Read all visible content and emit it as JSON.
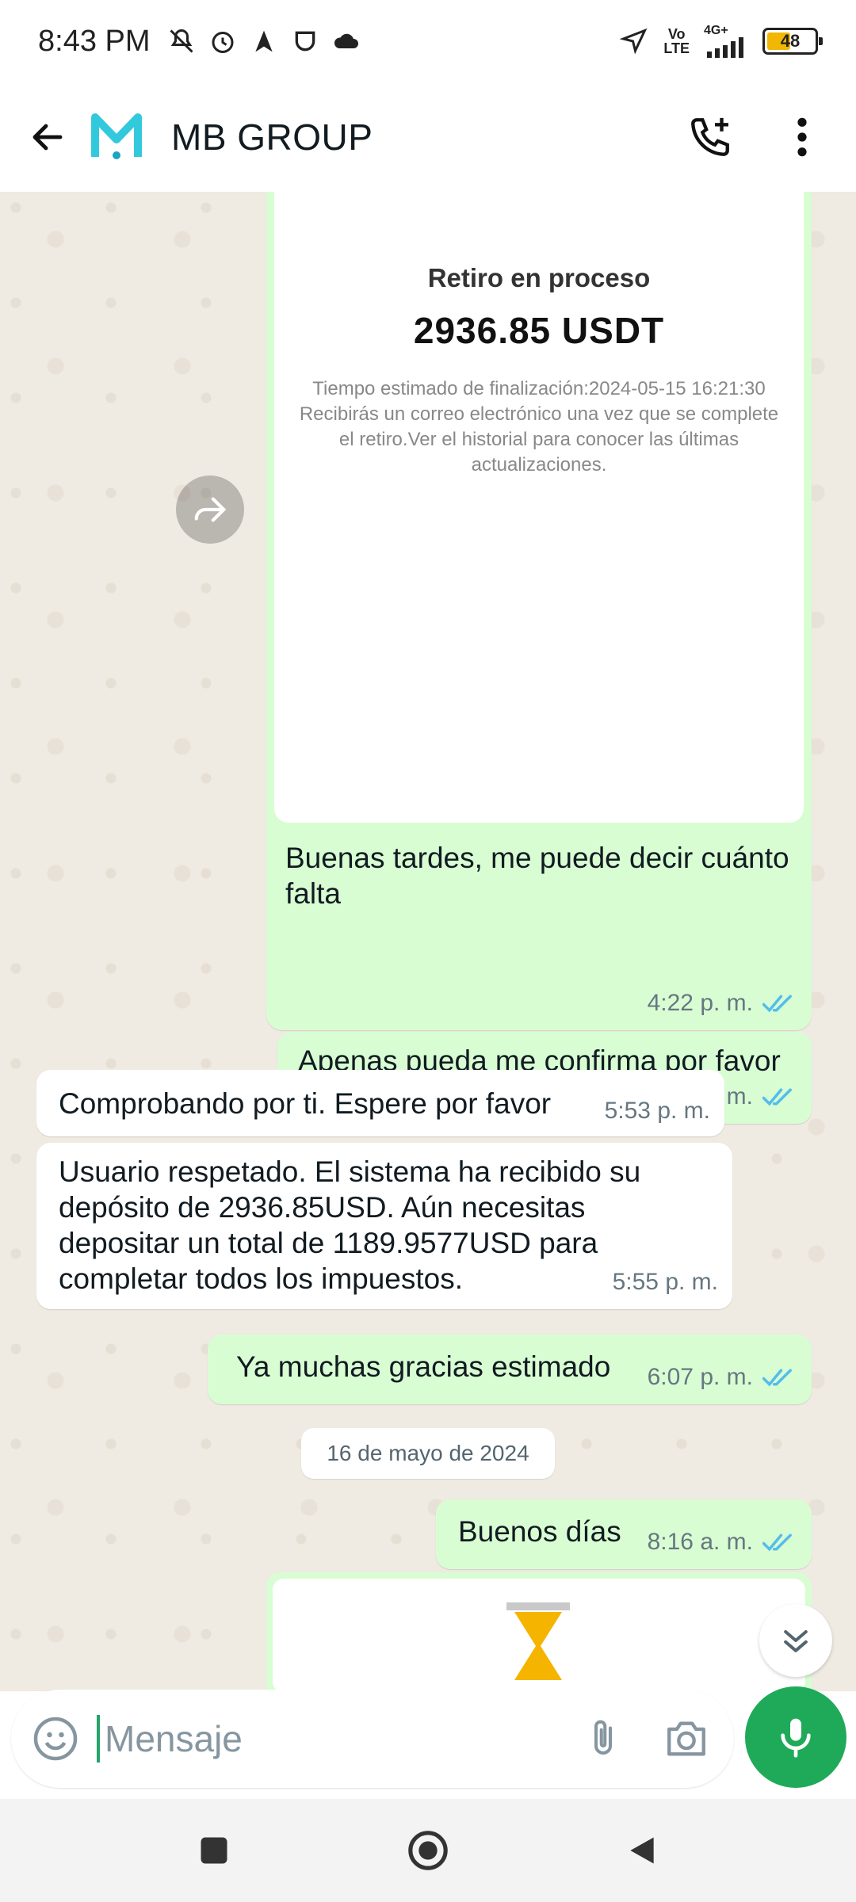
{
  "status_bar": {
    "time": "8:43 PM",
    "volte_top": "Vo",
    "volte_bottom": "LTE",
    "network": "4G+",
    "battery": "48"
  },
  "header": {
    "contact_name": "MB GROUP"
  },
  "messages": [
    {
      "type": "image",
      "image": {
        "title": "Retiro en proceso",
        "amount": "2936.85 USDT",
        "note": "Tiempo estimado de finalización:2024-05-15 16:21:30 Recibirás un correo electrónico una vez que se complete el retiro.Ver el historial para conocer las últimas actualizaciones."
      },
      "caption": "Buenas tardes, me puede decir cuánto falta",
      "time": "4:22 p. m.",
      "direction": "out"
    },
    {
      "text": "Apenas pueda me confirma por favor",
      "time": "5:28 p. m.",
      "direction": "out"
    },
    {
      "text": "Comprobando por ti. Espere por favor",
      "time": "5:53 p. m.",
      "direction": "in"
    },
    {
      "text": "Usuario respetado. El sistema ha recibido su depósito de 2936.85USD. Aún necesitas depositar un total de 1189.9577USD para completar todos los impuestos.",
      "time": "5:55 p. m.",
      "direction": "in"
    },
    {
      "text": "Ya muchas gracias estimado",
      "time": "6:07 p. m.",
      "direction": "out"
    },
    {
      "text": "Buenos días",
      "time": "8:16 a. m.",
      "direction": "out"
    }
  ],
  "date_separator": "16 de mayo de 2024",
  "composer": {
    "placeholder": "Mensaje"
  },
  "colors": {
    "outgoing_bubble": "#d9fdd3",
    "incoming_bubble": "#ffffff",
    "read_ticks": "#53bdeb",
    "mic_button": "#1faa59",
    "chat_background": "#efeae2"
  }
}
